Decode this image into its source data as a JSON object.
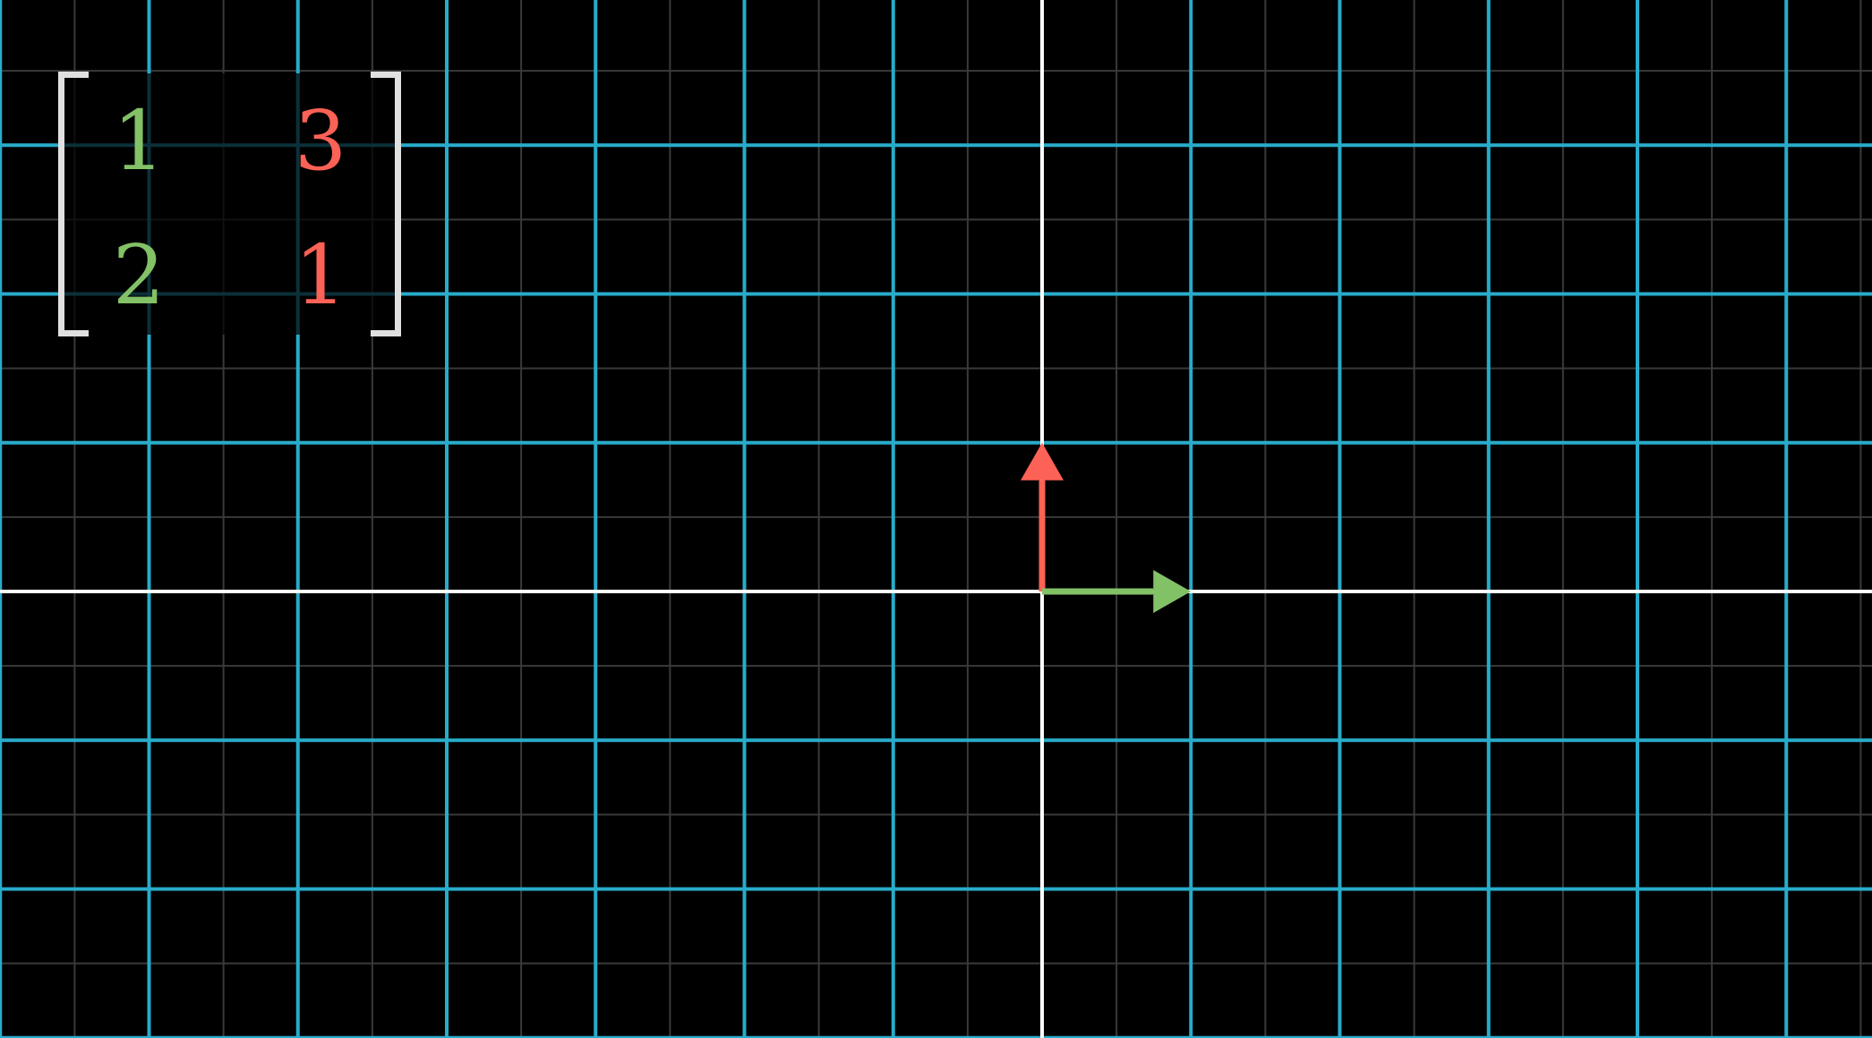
{
  "basis_vectors": {
    "i_hat": {
      "x": 1,
      "y": 0,
      "color": "#83c167"
    },
    "j_hat": {
      "x": 0,
      "y": 1,
      "color": "#fc6255"
    }
  },
  "grid": {
    "origin_screen": {
      "x": 1164,
      "y": 661
    },
    "unit": 166.25,
    "x_range": [
      -7,
      5
    ],
    "y_range": [
      -2,
      4
    ],
    "major_line_color": "#29abca",
    "minor_line_color": "#3a3a3a",
    "axis_color": "#ffffff"
  },
  "matrix": {
    "col1": {
      "top": "1",
      "bottom": "2",
      "color": "#83c167"
    },
    "col2": {
      "top": "3",
      "bottom": "1",
      "color": "#fc6255"
    },
    "bracket_color": "#e0e0e0"
  }
}
